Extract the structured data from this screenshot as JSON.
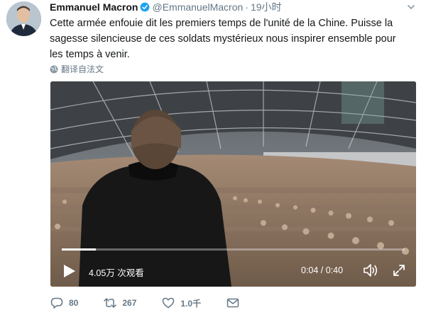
{
  "tweet": {
    "author_name": "Emmanuel Macron",
    "handle": "@EmmanuelMacron",
    "separator": "·",
    "time": "19小时",
    "text": "Cette armée enfouie dit les premiers temps de l'unité de la Chine. Puisse la sagesse silencieuse de ces soldats mystérieux nous inspirer ensemble pour les temps à venir.",
    "translate_label": "翻译自法文"
  },
  "video": {
    "views": "4.05万 次观看",
    "time_display": "0:04 / 0:40",
    "progress": 0.1
  },
  "actions": {
    "replies": "80",
    "retweets": "267",
    "likes": "1.0千"
  },
  "colors": {
    "verified": "#1da1f2",
    "secondary_text": "#657786"
  }
}
